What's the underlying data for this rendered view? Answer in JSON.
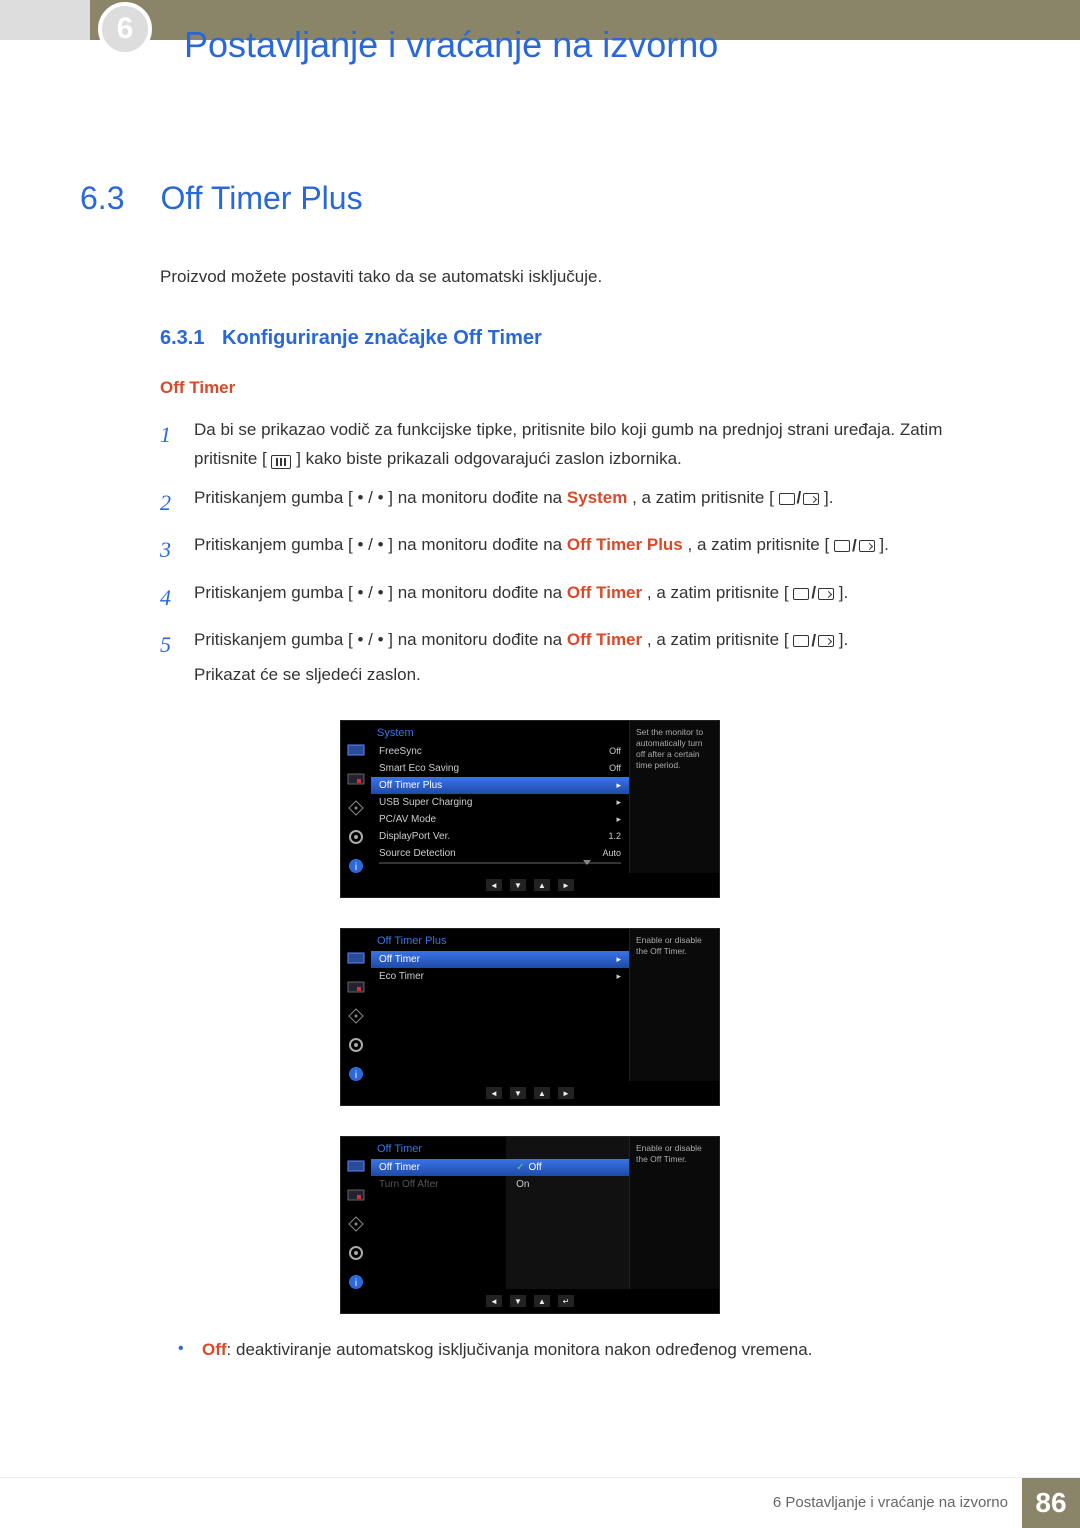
{
  "chapter": {
    "badge": "6",
    "title": "Postavljanje i vraćanje na izvorno"
  },
  "section": {
    "num": "6.3",
    "title": "Off Timer Plus",
    "intro": "Proizvod možete postaviti tako da se automatski isključuje."
  },
  "subsection": {
    "num": "6.3.1",
    "title": "Konfiguriranje značajke Off Timer",
    "subheading": "Off Timer"
  },
  "steps": [
    {
      "n": "1",
      "pre": "Da bi se prikazao vodič za funkcijske tipke, pritisnite bilo koji gumb na prednjoj strani uređaja. Zatim pritisnite [",
      "post": "] kako biste prikazali odgovarajući zaslon izbornika."
    },
    {
      "n": "2",
      "pre": "Pritiskanjem gumba [ • / • ] na monitoru dođite na ",
      "hl": "System",
      "post1": ", a zatim pritisnite [",
      "post2": "]."
    },
    {
      "n": "3",
      "pre": "Pritiskanjem gumba [ • / • ] na monitoru dođite na ",
      "hl": "Off Timer Plus",
      "post1": ", a zatim pritisnite [",
      "post2": "]."
    },
    {
      "n": "4",
      "pre": "Pritiskanjem gumba [ • / • ] na monitoru dođite na ",
      "hl": "Off Timer",
      "post1": ", a zatim pritisnite [",
      "post2": "]."
    },
    {
      "n": "5",
      "pre": "Pritiskanjem gumba [ • / • ] na monitoru dođite na ",
      "hl": "Off Timer",
      "post1": ", a zatim pritisnite [",
      "post2": "].",
      "trail": "Prikazat će se sljedeći zaslon."
    }
  ],
  "osd1": {
    "title": "System",
    "items": [
      {
        "label": "FreeSync",
        "value": "Off"
      },
      {
        "label": "Smart Eco Saving",
        "value": "Off"
      },
      {
        "label": "Off Timer Plus",
        "value": "▸",
        "selected": true
      },
      {
        "label": "USB Super Charging",
        "value": "▸"
      },
      {
        "label": "PC/AV Mode",
        "value": "▸"
      },
      {
        "label": "DisplayPort Ver.",
        "value": "1.2"
      },
      {
        "label": "Source Detection",
        "value": "Auto"
      }
    ],
    "help": "Set the monitor to automatically turn off after a certain time period."
  },
  "osd2": {
    "title": "Off Timer Plus",
    "items": [
      {
        "label": "Off Timer",
        "value": "▸",
        "selected": true
      },
      {
        "label": "Eco Timer",
        "value": "▸"
      }
    ],
    "help": "Enable or disable the Off Timer."
  },
  "osd3": {
    "title": "Off Timer",
    "items": [
      {
        "label": "Off Timer",
        "selected": true
      },
      {
        "label": "Turn Off After",
        "dim": true
      }
    ],
    "sub": [
      {
        "label": "Off",
        "checked": true,
        "selected": true
      },
      {
        "label": "On"
      }
    ],
    "help": "Enable or disable the Off Timer."
  },
  "nav_glyphs": [
    "◄",
    "▼",
    "▲",
    "►"
  ],
  "nav_glyphs3": [
    "◄",
    "▼",
    "▲",
    "↵"
  ],
  "bullet": {
    "hl": "Off",
    "text": ": deaktiviranje automatskog isključivanja monitora nakon određenog vremena."
  },
  "footer": {
    "text": "6 Postavljanje i vraćanje na izvorno",
    "page": "86"
  }
}
